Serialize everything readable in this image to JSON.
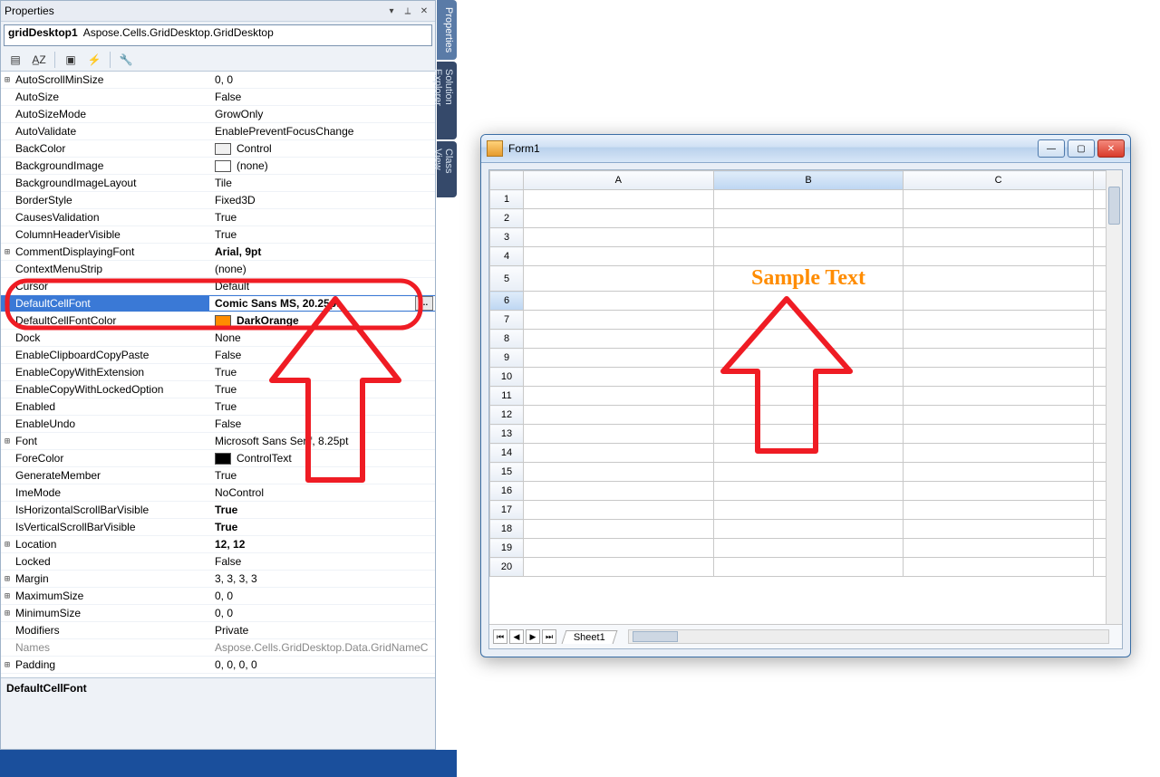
{
  "panel": {
    "title": "Properties",
    "combo_name": "gridDesktop1",
    "combo_type": "Aspose.Cells.GridDesktop.GridDesktop",
    "desc_name": "DefaultCellFont"
  },
  "side_tabs": [
    "Properties",
    "Solution Explorer",
    "Class View"
  ],
  "props": [
    {
      "exp": "+",
      "name": "AutoScrollMinSize",
      "value": "0, 0"
    },
    {
      "exp": "",
      "name": "AutoSize",
      "value": "False"
    },
    {
      "exp": "",
      "name": "AutoSizeMode",
      "value": "GrowOnly"
    },
    {
      "exp": "",
      "name": "AutoValidate",
      "value": "EnablePreventFocusChange"
    },
    {
      "exp": "",
      "name": "BackColor",
      "value": "Control",
      "swatch": "#f0f0f0"
    },
    {
      "exp": "",
      "name": "BackgroundImage",
      "value": "(none)",
      "swatch": "#ffffff"
    },
    {
      "exp": "",
      "name": "BackgroundImageLayout",
      "value": "Tile"
    },
    {
      "exp": "",
      "name": "BorderStyle",
      "value": "Fixed3D"
    },
    {
      "exp": "",
      "name": "CausesValidation",
      "value": "True"
    },
    {
      "exp": "",
      "name": "ColumnHeaderVisible",
      "value": "True"
    },
    {
      "exp": "+",
      "name": "CommentDisplayingFont",
      "value": "Arial, 9pt",
      "bold": true
    },
    {
      "exp": "",
      "name": "ContextMenuStrip",
      "value": "(none)"
    },
    {
      "exp": "",
      "name": "Cursor",
      "value": "Default"
    },
    {
      "exp": "+",
      "name": "DefaultCellFont",
      "value": "Comic Sans MS, 20.25pt",
      "bold": true,
      "selected": true,
      "ellipsis": true
    },
    {
      "exp": "",
      "name": "DefaultCellFontColor",
      "value": "DarkOrange",
      "bold": true,
      "swatch": "#ff8c00"
    },
    {
      "exp": "",
      "name": "Dock",
      "value": "None"
    },
    {
      "exp": "",
      "name": "EnableClipboardCopyPaste",
      "value": "False"
    },
    {
      "exp": "",
      "name": "EnableCopyWithExtension",
      "value": "True"
    },
    {
      "exp": "",
      "name": "EnableCopyWithLockedOption",
      "value": "True"
    },
    {
      "exp": "",
      "name": "Enabled",
      "value": "True"
    },
    {
      "exp": "",
      "name": "EnableUndo",
      "value": "False"
    },
    {
      "exp": "+",
      "name": "Font",
      "value": "Microsoft Sans Serif, 8.25pt"
    },
    {
      "exp": "",
      "name": "ForeColor",
      "value": "ControlText",
      "swatch": "#000000"
    },
    {
      "exp": "",
      "name": "GenerateMember",
      "value": "True"
    },
    {
      "exp": "",
      "name": "ImeMode",
      "value": "NoControl"
    },
    {
      "exp": "",
      "name": "IsHorizontalScrollBarVisible",
      "value": "True",
      "bold": true
    },
    {
      "exp": "",
      "name": "IsVerticalScrollBarVisible",
      "value": "True",
      "bold": true
    },
    {
      "exp": "+",
      "name": "Location",
      "value": "12, 12",
      "bold": true
    },
    {
      "exp": "",
      "name": "Locked",
      "value": "False"
    },
    {
      "exp": "+",
      "name": "Margin",
      "value": "3, 3, 3, 3"
    },
    {
      "exp": "+",
      "name": "MaximumSize",
      "value": "0, 0"
    },
    {
      "exp": "+",
      "name": "MinimumSize",
      "value": "0, 0"
    },
    {
      "exp": "",
      "name": "Modifiers",
      "value": "Private"
    },
    {
      "exp": "",
      "name": "Names",
      "value": "Aspose.Cells.GridDesktop.Data.GridNameC",
      "disabled": true
    },
    {
      "exp": "+",
      "name": "Padding",
      "value": "0, 0, 0, 0"
    }
  ],
  "form": {
    "title": "Form1",
    "columns": [
      "A",
      "B",
      "C"
    ],
    "rows": 20,
    "selected_row": 6,
    "selected_col": 1,
    "sample_text": "Sample Text",
    "sample_row": 5,
    "sample_col": 1,
    "sheet_name": "Sheet1"
  },
  "colors": {
    "highlight_row": "#3a79d6",
    "dark_orange": "#ff8c00",
    "annotation": "#ef1c24"
  }
}
